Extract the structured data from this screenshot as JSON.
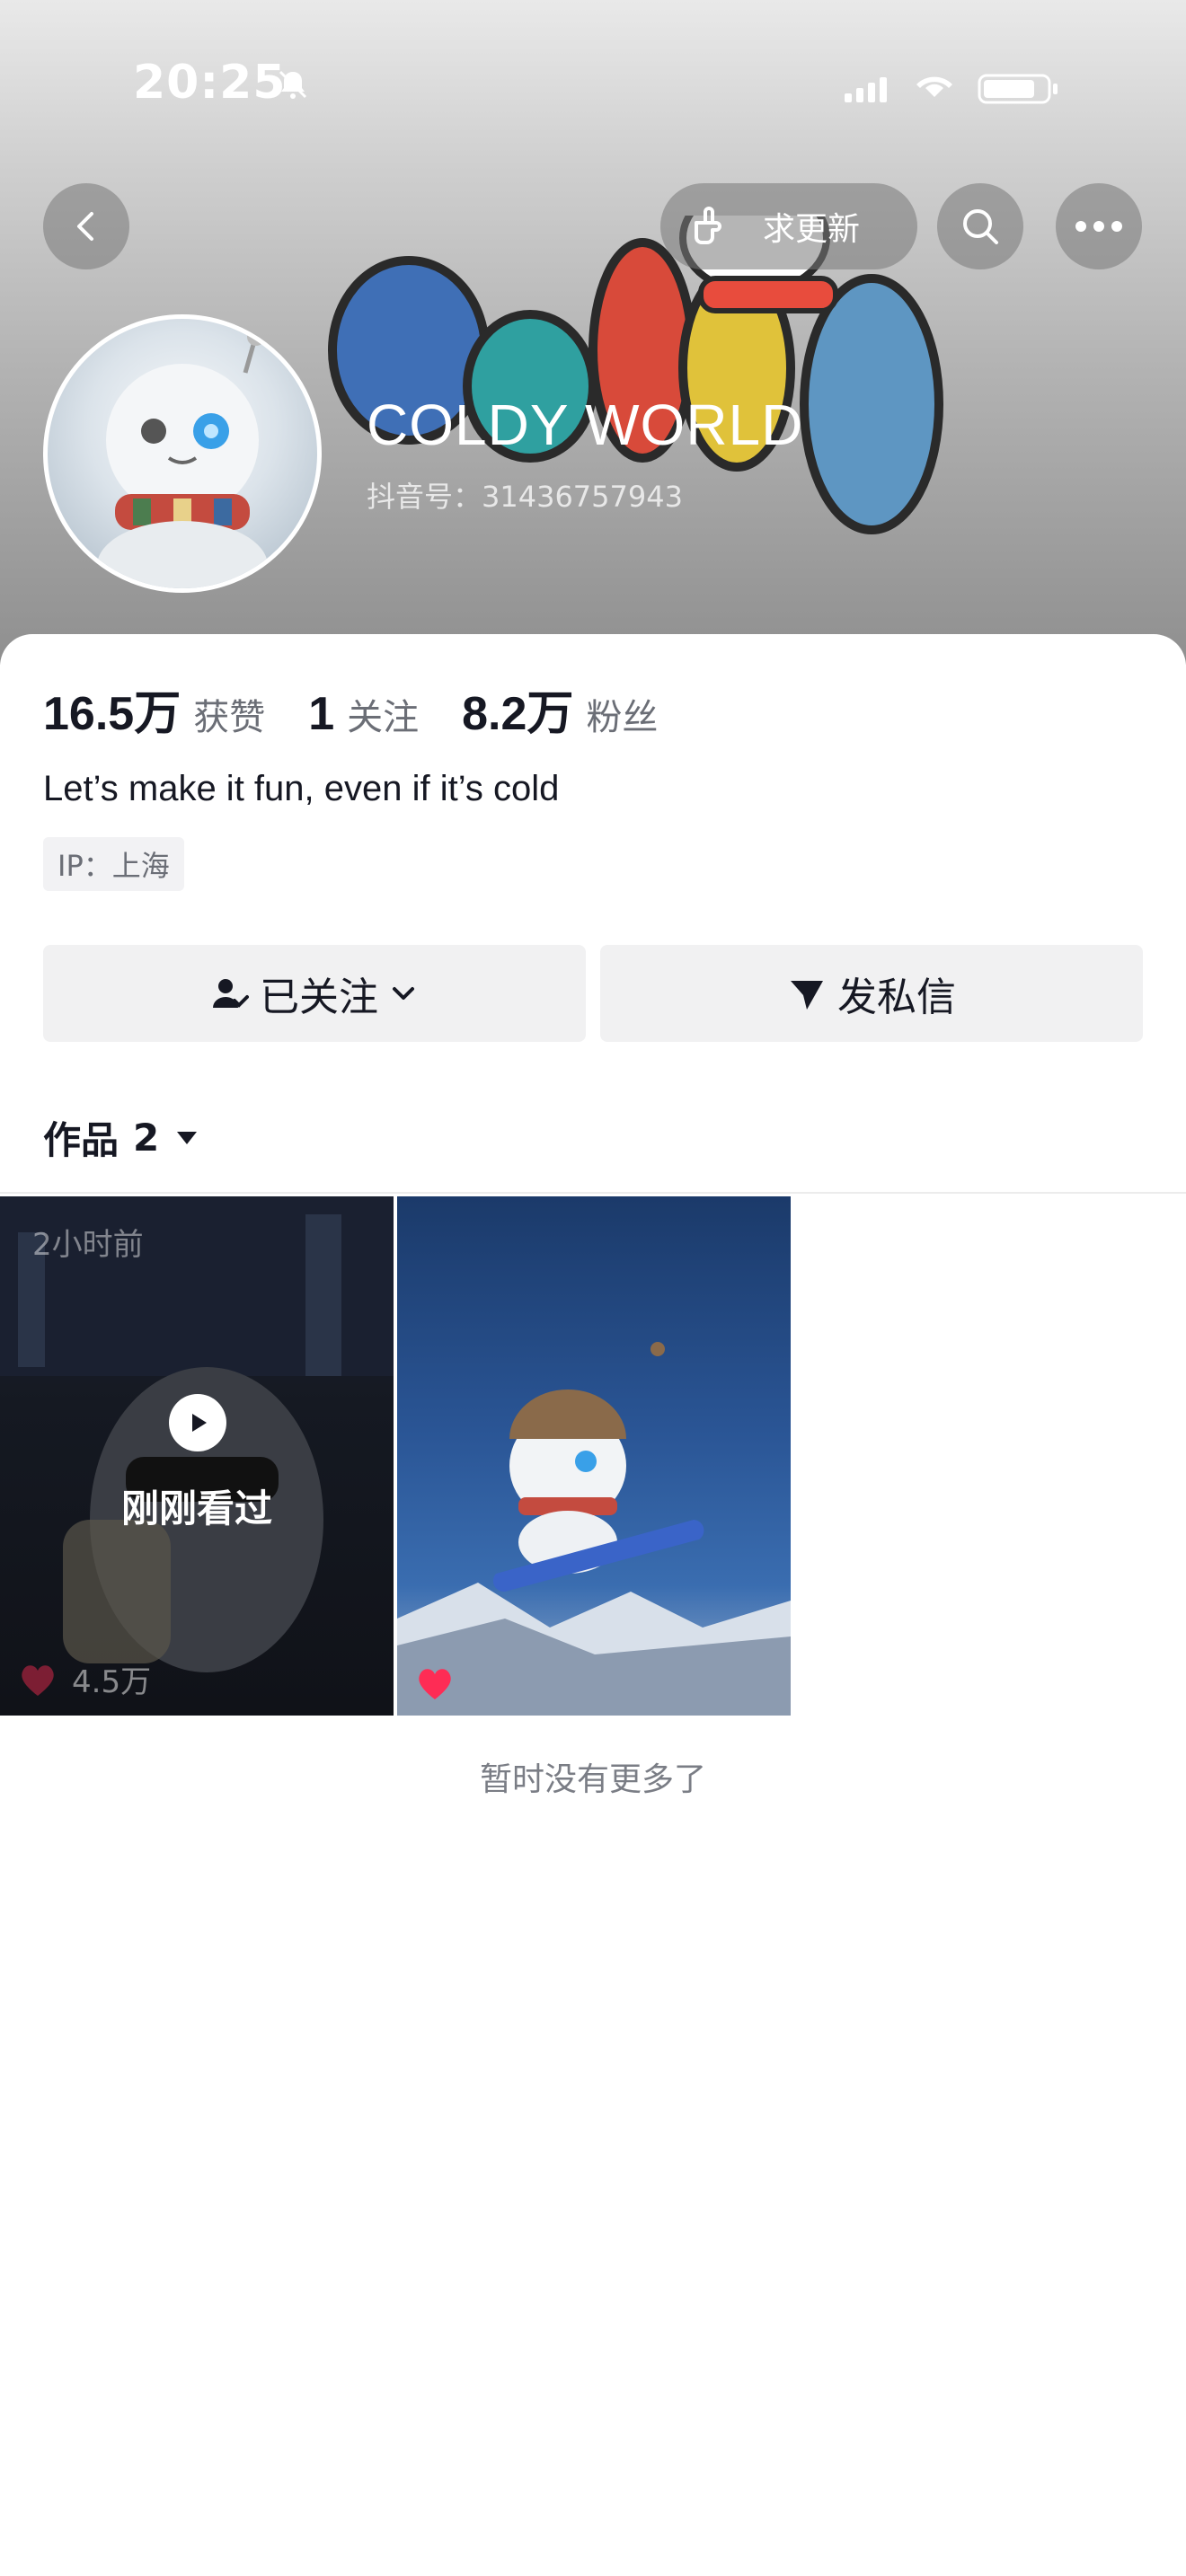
{
  "status_bar": {
    "time": "20:25"
  },
  "header": {
    "update_button_label": "求更新",
    "profile_name": "COLDY WORLD",
    "douyin_id": "抖音号：31436757943"
  },
  "stats": [
    {
      "value": "16.5万",
      "label": "获赞"
    },
    {
      "value": "1",
      "label": "关注"
    },
    {
      "value": "8.2万",
      "label": "粉丝"
    }
  ],
  "bio": "Let’s make it fun, even if it’s cold",
  "ip_location": "IP：上海",
  "actions": {
    "followed_label": "已关注",
    "message_label": "发私信"
  },
  "works": {
    "tab_label": "作品",
    "count": "2",
    "videos": [
      {
        "time_ago": "2小时前",
        "overlay": "刚刚看过",
        "likes": "4.5万"
      },
      {
        "likes": ""
      }
    ],
    "end_text": "暂时没有更多了"
  },
  "colors": {
    "like_red": "#fe2c55",
    "accent": "#161823"
  }
}
